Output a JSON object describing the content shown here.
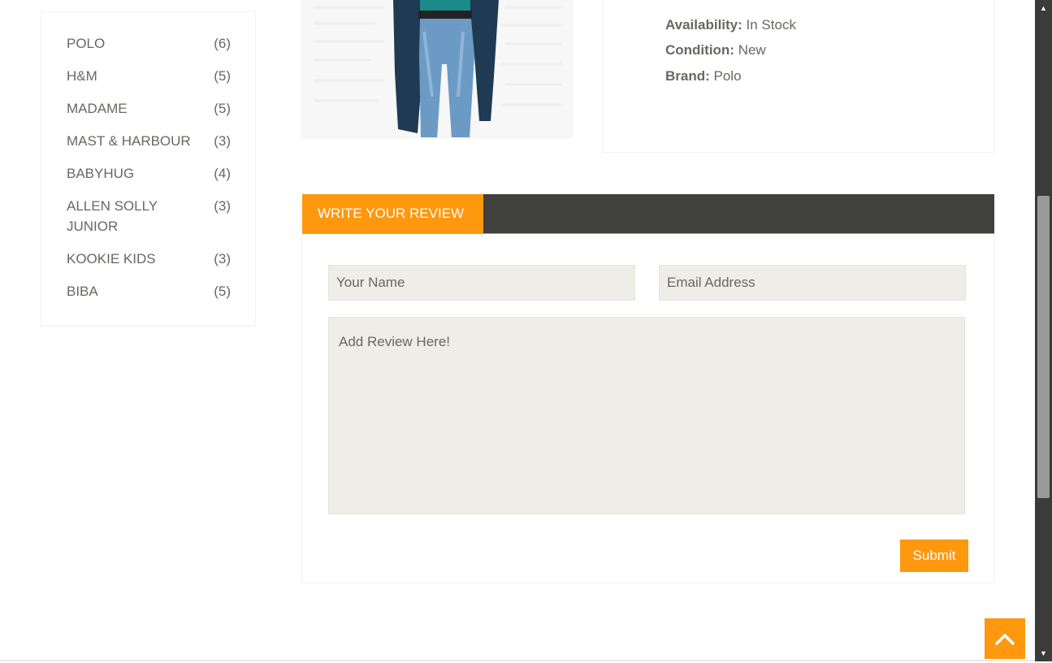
{
  "brands": [
    {
      "name": "POLO",
      "count": "(6)"
    },
    {
      "name": "H&M",
      "count": "(5)"
    },
    {
      "name": "MADAME",
      "count": "(5)"
    },
    {
      "name": "MAST & HARBOUR",
      "count": "(3)"
    },
    {
      "name": "BABYHUG",
      "count": "(4)"
    },
    {
      "name": "ALLEN SOLLY JUNIOR",
      "count": "(3)"
    },
    {
      "name": "KOOKIE KIDS",
      "count": "(3)"
    },
    {
      "name": "BIBA",
      "count": "(5)"
    }
  ],
  "product": {
    "availability_label": "Availability:",
    "availability_value": "In Stock",
    "condition_label": "Condition:",
    "condition_value": "New",
    "brand_label": "Brand:",
    "brand_value": "Polo"
  },
  "review": {
    "tab_label": "WRITE YOUR REVIEW",
    "name_placeholder": "Your Name",
    "email_placeholder": "Email Address",
    "review_placeholder": "Add Review Here!",
    "submit_label": "Submit"
  },
  "colors": {
    "accent": "#FE980F",
    "tab_bar": "#40403e",
    "field_bg": "#eeede7",
    "text": "#696763"
  },
  "icons": {
    "scroll_up": "chevron-up-icon",
    "scroll_top": "chevron-up-icon"
  }
}
